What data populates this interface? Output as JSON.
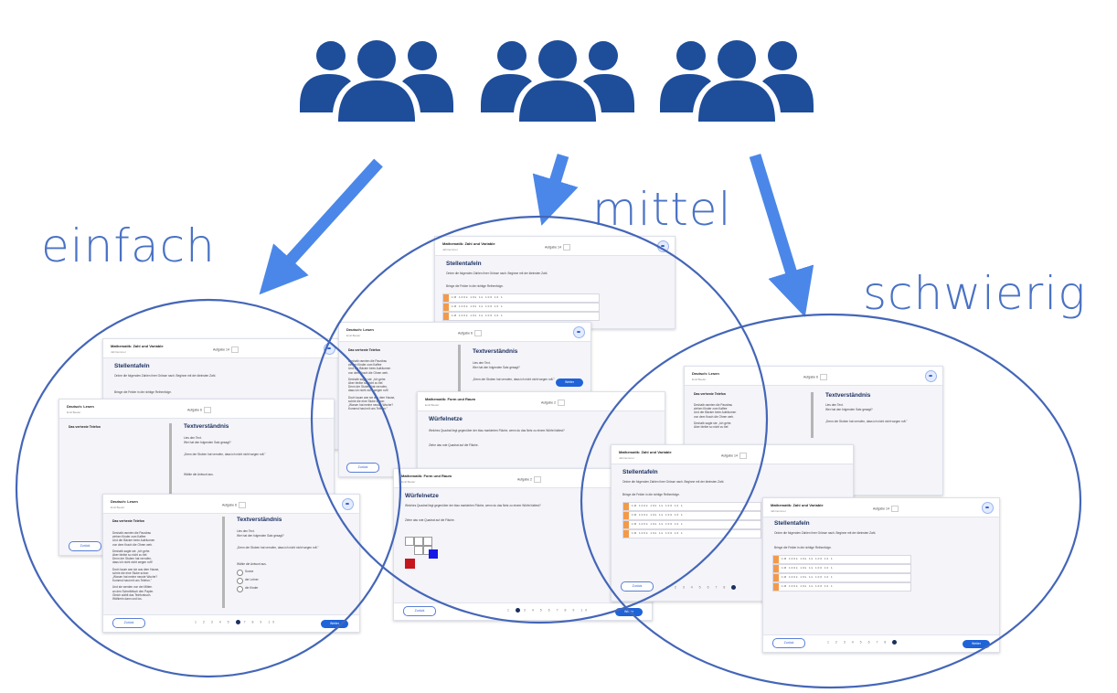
{
  "labels": {
    "easy": "einfach",
    "medium": "mittel",
    "hard": "schwierig"
  },
  "colors": {
    "people": "#1e4d9a",
    "arrow": "#4b87e8",
    "circle": "#4466b8",
    "label": "#4a72c4",
    "primary_button": "#1e63d8"
  },
  "icons": [
    "user-group-icon",
    "user-group-icon",
    "user-group-icon"
  ],
  "cards": {
    "math_zahl": {
      "header": "Mathematik: Zahl und Variable",
      "header_sub": "Jahrnummer",
      "task": "Aufgabe 14",
      "title": "Stellentafeln",
      "instruction": "Ordne die folgenden Zahlen ihrer Grösse nach. Beginne mit der kleinsten Zahl.",
      "hint": "Bringe die Felder in die richtige Reihenfolge.",
      "rows": [
        "1M 100k 10k 1k 100 10 1",
        "1M 100k 10k 1k 100 10 1",
        "1M 100k 10k 1k 100 10 1",
        "1M 100k 10k 1k 100 10 1"
      ]
    },
    "deutsch_lesen": {
      "header": "Deutsch: Lesen",
      "header_sub": "Emil Beeler",
      "task": "Aufgabe 6",
      "story_title": "Das verhexte Telefon",
      "story_lines": [
        "Deshalb rannten die Pausfrau",
        "ziehen Kinder zum Kaffee",
        "Und der Bäcker beim Aufräumen",
        "von dem Krach die Ohren weh.",
        "Deshalb sagte sie: „Ich gehe.",
        "Aber bleibe so nicht zu tief.",
        "Denn der Stuben hat verrufen,",
        "dass ich nicht nicht wegen ruft!",
        "Doch kaum war sie aus dem Hause,",
        "schrie die eine Stube schon:",
        "„Warum hat meine neuste Woche?",
        "Kommst hast mit uns Telefon.\"",
        "Und sie werden von der Mitten",
        "an den Schreibtisch den Papier.",
        "Gleich wählt das Telefonbuch.",
        "Wählerin dann und los."
      ],
      "title": "Textverständnis",
      "prompt": "Lies den Text.",
      "question": "Wer hat den folgenden Satz gesagt?",
      "quote": "„Denn der Stuben hat verrufen, dass ich nicht nicht wegen ruft.\"",
      "select_hint": "Wähle die Antwort aus.",
      "options": [
        "Sonne",
        "der Lehrer",
        "die Kinder"
      ]
    },
    "math_form": {
      "header": "Mathematik: Form und Raum",
      "header_sub": "Emil Beeler",
      "task": "Aufgabe 2",
      "title": "Würfelnetze",
      "instruction": "Welches Quadrat liegt gegenüber der blau markierten Fläche, wenn du das Netz zu einem Würfel faltest?",
      "hint": "Ziehe das rote Quadrat auf die Fläche."
    },
    "buttons": {
      "back": "Zurück",
      "next": "Weiter"
    },
    "pagination": "1 2 3 4 5 6 7 8 9 10"
  }
}
